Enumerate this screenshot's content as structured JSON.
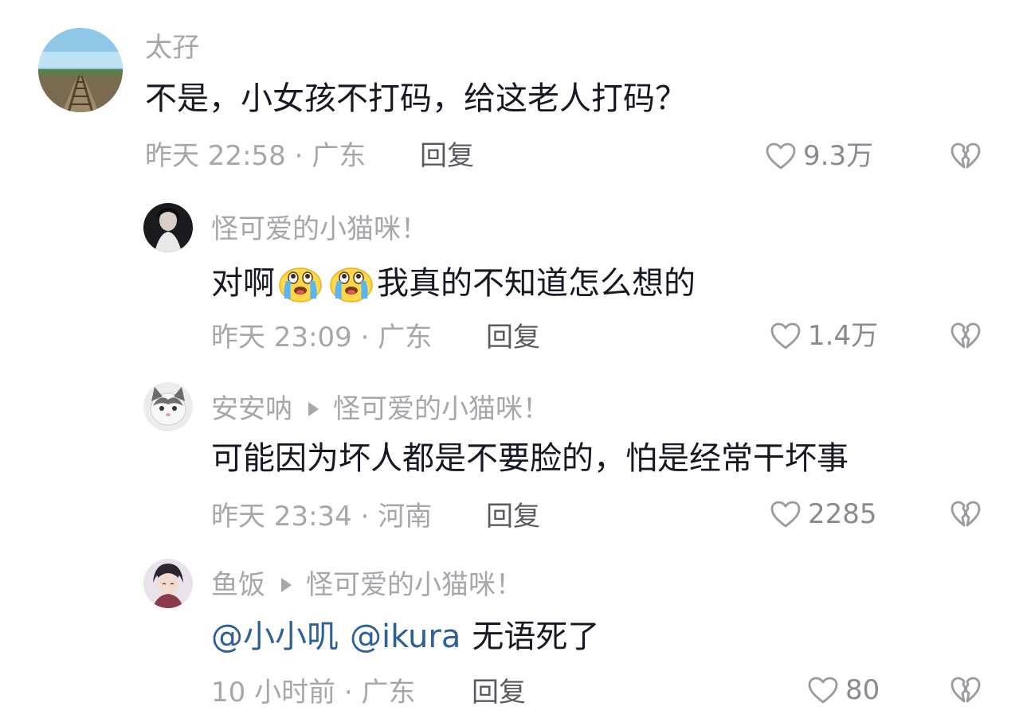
{
  "comments": [
    {
      "author": "太孖",
      "text": "不是，小女孩不打码，给这老人打码？",
      "meta": "昨天 22:58 · 广东",
      "reply_label": "回复",
      "likes": "9.3万"
    },
    {
      "author": "怪可爱的小猫咪！",
      "text_before": "对啊",
      "emoji": "crying-face-emoji",
      "text_after": "我真的不知道怎么想的",
      "meta": "昨天 23:09 · 广东",
      "reply_label": "回复",
      "likes": "1.4万"
    },
    {
      "author": "安安呐",
      "reply_to": "怪可爱的小猫咪！",
      "text": "可能因为坏人都是不要脸的，怕是经常干坏事",
      "meta": "昨天 23:34 · 河南",
      "reply_label": "回复",
      "likes": "2285"
    },
    {
      "author": "鱼饭",
      "reply_to": "怪可爱的小猫咪！",
      "mention1": "@小小叽",
      "mention2": "@ikura",
      "text": "无语死了",
      "meta": "10 小时前 · 广东",
      "reply_label": "回复",
      "likes": "80"
    }
  ],
  "icons": {
    "like": "heart-outline-icon",
    "dislike": "broken-heart-icon"
  },
  "colors": {
    "text": "#161823",
    "muted": "#a6a6ab",
    "mention": "#2d5f99"
  }
}
